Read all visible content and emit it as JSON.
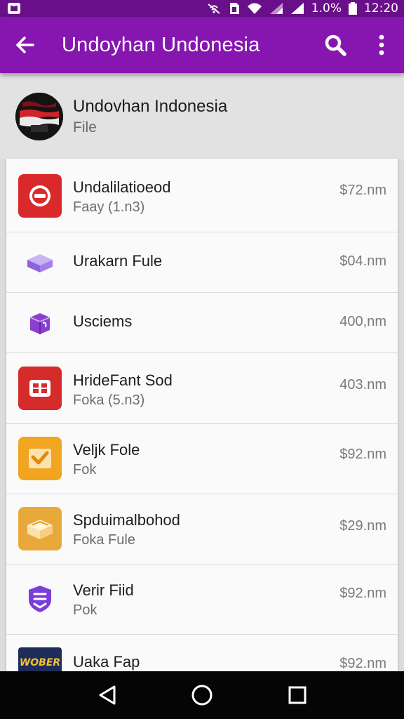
{
  "status_bar": {
    "battery": "1.0%",
    "time": "12:20",
    "icons": [
      "notification-icon",
      "mute-icon",
      "sim-icon",
      "wifi-icon",
      "signal-icon",
      "battery-icon"
    ]
  },
  "app_bar": {
    "title": "Undoyhan Undonesia",
    "back_icon": "arrow-left-icon",
    "search_icon": "search-icon",
    "more_icon": "more-vertical-icon"
  },
  "header": {
    "title": "Undovhan Indonesia",
    "subtitle": "File"
  },
  "items": [
    {
      "title": "Undalilatioeod",
      "subtitle": "Faay (1.n3)",
      "size": "$72.nm",
      "icon": "red-file-icon",
      "color": "#d9292b"
    },
    {
      "title": "Urakarn Fule",
      "subtitle": "",
      "size": "$04.nm",
      "icon": "purple-box-icon",
      "color": "#9b6fe0"
    },
    {
      "title": "Usciems",
      "subtitle": "",
      "size": "400,nm",
      "icon": "purple-package-icon",
      "color": "#8a3fd0"
    },
    {
      "title": "HrideFant Sod",
      "subtitle": "Foka (5.n3)",
      "size": "403.nm",
      "icon": "red-grid-icon",
      "color": "#d52b2b"
    },
    {
      "title": "Veljk Fole",
      "subtitle": "Fok",
      "size": "$92.nm",
      "icon": "check-mail-icon",
      "color": "#f1a520"
    },
    {
      "title": "Spduimalbohod",
      "subtitle": "Foka Fule",
      "size": "$29.nm",
      "icon": "open-box-icon",
      "color": "#e9a93a"
    },
    {
      "title": "Verir Fiid",
      "subtitle": "Pok",
      "size": "$92.nm",
      "icon": "purple-shield-icon",
      "color": "#7b3fd8"
    },
    {
      "title": "Uaka Fap",
      "subtitle": "",
      "size": "$92.nm",
      "icon": "game-logo-icon",
      "color": "#1d2c5a",
      "logo_text": "WOBER"
    }
  ],
  "nav_bar": {
    "icons": [
      "back-triangle-icon",
      "home-circle-icon",
      "recents-square-icon"
    ]
  }
}
